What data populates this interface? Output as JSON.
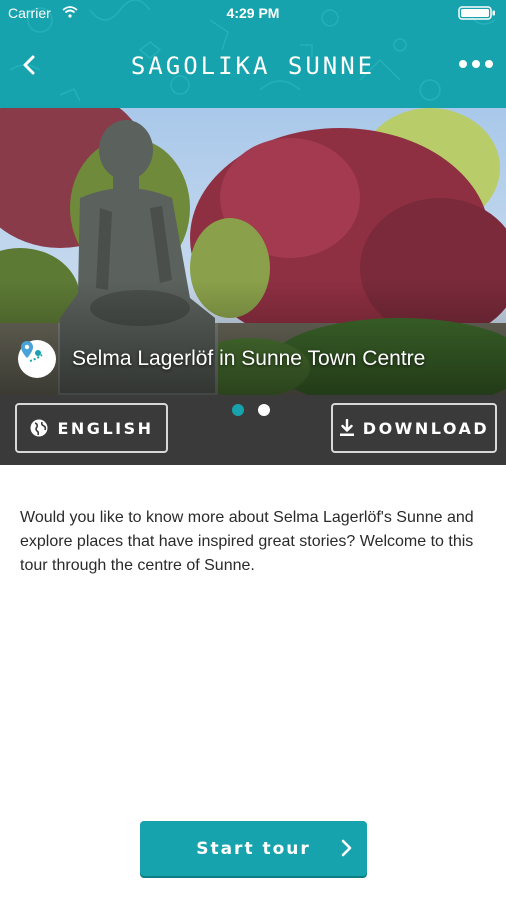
{
  "status_bar": {
    "carrier": "Carrier",
    "time": "4:29 PM",
    "wifi_icon": "wifi-icon",
    "battery_icon": "battery-icon"
  },
  "navbar": {
    "title": "SAGOLIKA SUNNE",
    "back_icon": "chevron-left-icon",
    "more_icon": "more-horizontal-icon",
    "background_color": "#17a3ad"
  },
  "hero": {
    "title": "Selma Lagerlöf in Sunne Town Centre",
    "badge_icon": "map-pin-icon"
  },
  "carousel": {
    "page_count": 2,
    "active_index": 0
  },
  "actions": {
    "language_label": "ENGLISH",
    "language_icon": "globe-icon",
    "download_label": "DOWNLOAD",
    "download_icon": "download-icon"
  },
  "description": "Would you like to know more about Selma Lagerlöf's Sunne and explore places that have inspired great stories? Welcome to this tour through the centre of Sunne.",
  "start_button": {
    "label": "Start tour",
    "icon": "chevron-right-icon",
    "color": "#17a3ad"
  }
}
